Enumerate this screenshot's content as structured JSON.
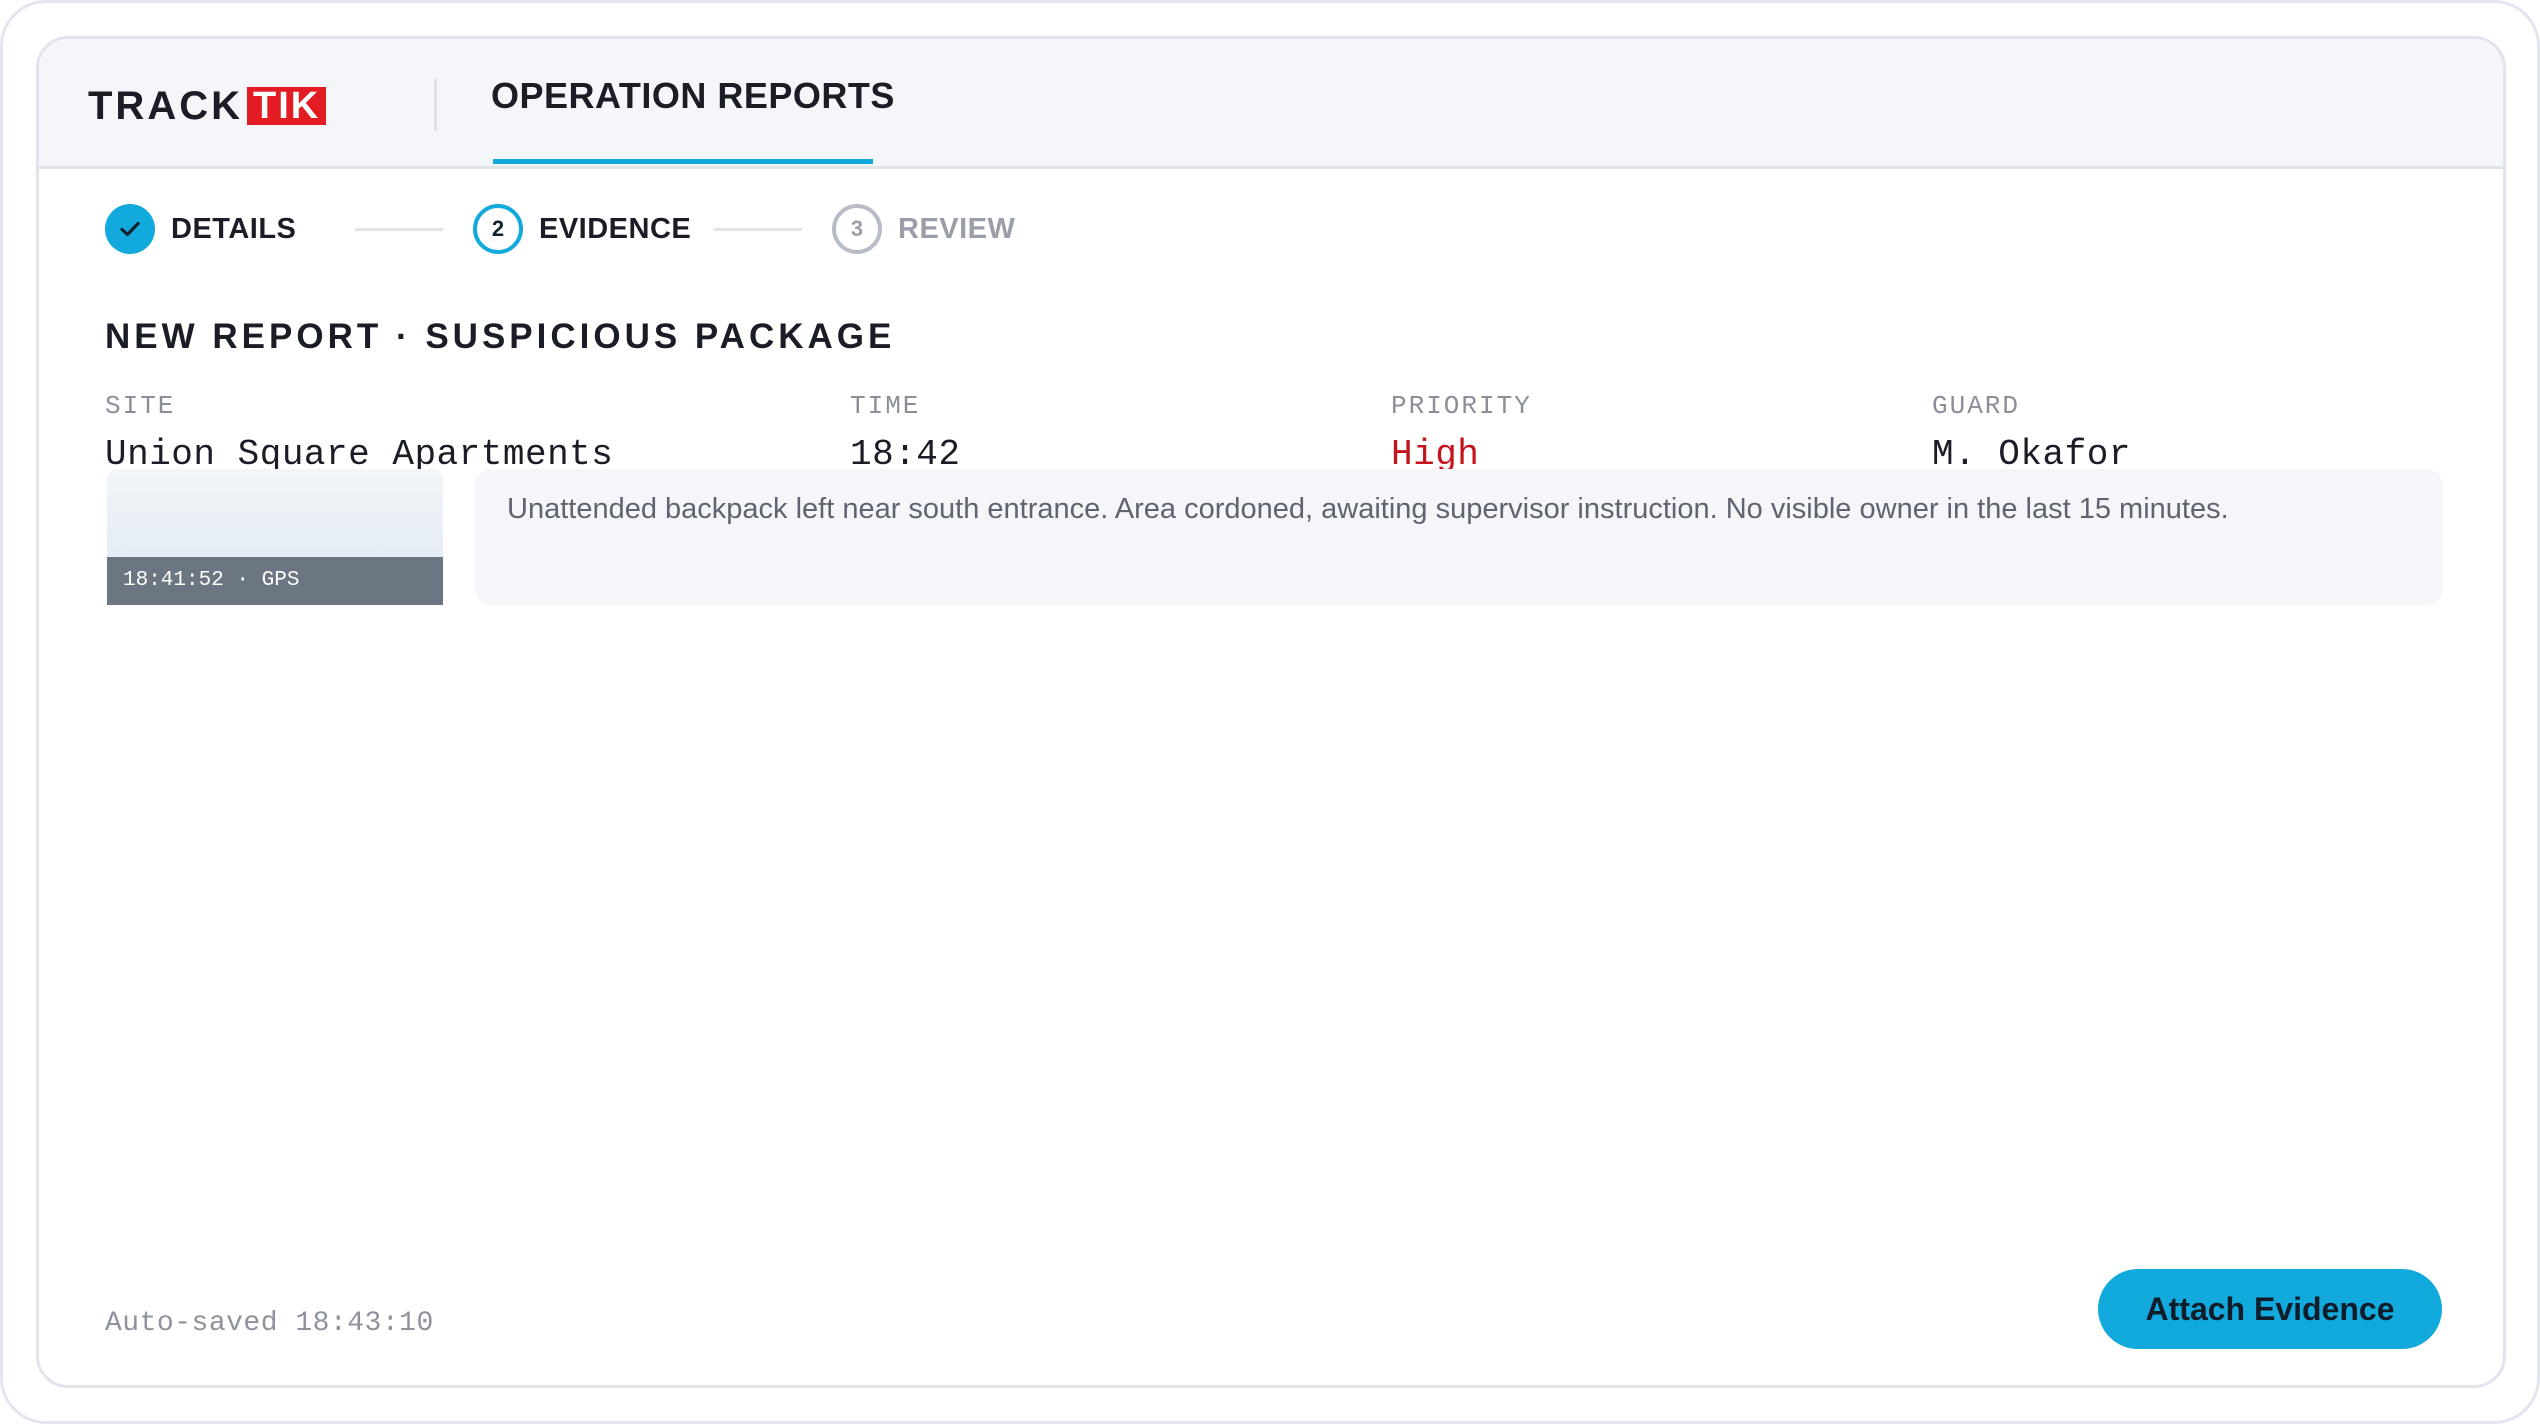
{
  "brand": {
    "logo_part_1": "TRACK",
    "logo_part_2": "TIK",
    "accent_color": "#12a9dc",
    "logo_red": "#e31b23"
  },
  "header": {
    "title": "OPERATION REPORTS"
  },
  "stepper": {
    "steps": [
      {
        "number": "1",
        "label": "DETAILS",
        "state": "done",
        "icon": "check-icon"
      },
      {
        "number": "2",
        "label": "EVIDENCE",
        "state": "active"
      },
      {
        "number": "3",
        "label": "REVIEW",
        "state": "todo"
      }
    ]
  },
  "report": {
    "title": "NEW REPORT · SUSPICIOUS PACKAGE",
    "fields": [
      {
        "label": "SITE",
        "value": "Union Square Apartments"
      },
      {
        "label": "TIME",
        "value": "18:42"
      },
      {
        "label": "PRIORITY",
        "value": "High",
        "color": "#c4131d"
      },
      {
        "label": "GUARD",
        "value": "M. Okafor"
      }
    ],
    "evidence_thumbnail": {
      "caption": "18:41:52 · GPS"
    },
    "note": "Unattended backpack left near south entrance. Area cordoned, awaiting supervisor instruction. No visible owner in the last 15 minutes."
  },
  "footer": {
    "autosave": "Auto-saved 18:43:10",
    "primary_button": "Attach Evidence"
  }
}
